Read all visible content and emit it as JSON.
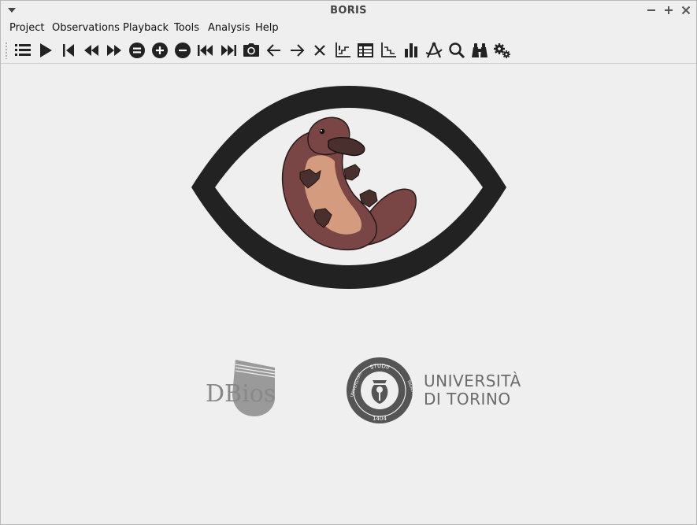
{
  "window": {
    "title": "BORIS"
  },
  "menubar": {
    "items": [
      "Project",
      "Observations",
      "Playback",
      "Tools",
      "Analysis",
      "Help"
    ]
  },
  "icons": {
    "toolbar": [
      "list-icon",
      "play-icon",
      "skip-back-icon",
      "rewind-icon",
      "fast-forward-icon",
      "equal-circle-icon",
      "plus-circle-icon",
      "minus-circle-icon",
      "skip-previous-icon",
      "skip-next-icon",
      "camera-icon",
      "arrow-left-icon",
      "arrow-right-icon",
      "close-icon",
      "plot-events-icon",
      "table-icon",
      "plot-steps-icon",
      "bar-chart-icon",
      "compass-icon",
      "search-icon",
      "binoculars-icon",
      "gears-icon"
    ]
  },
  "logos": {
    "dbios": "DBios",
    "unito_line1": "UNIVERSITÀ",
    "unito_line2": "DI TORINO",
    "seal_top": "STUDII",
    "seal_left": "UNIVERSITAS",
    "seal_right": "TAURINENSIS",
    "seal_year": "1404"
  },
  "colors": {
    "eye": "#222222",
    "platypus_body": "#7a4545",
    "platypus_belly": "#d49b7e",
    "platypus_feet": "#4a2f2f"
  }
}
